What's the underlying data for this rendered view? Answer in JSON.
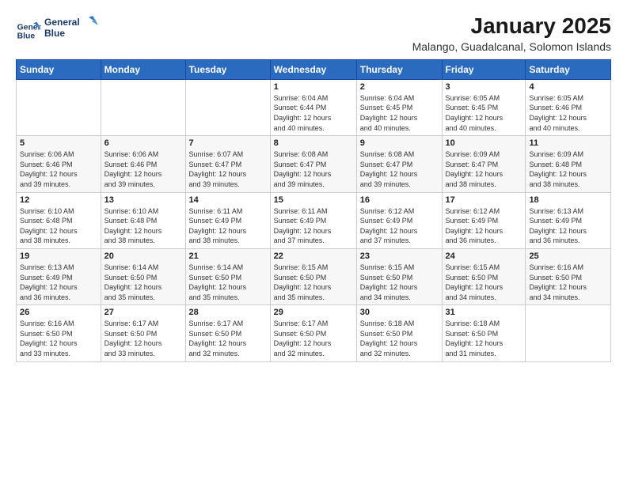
{
  "logo": {
    "line1": "General",
    "line2": "Blue"
  },
  "title": "January 2025",
  "subtitle": "Malango, Guadalcanal, Solomon Islands",
  "weekdays": [
    "Sunday",
    "Monday",
    "Tuesday",
    "Wednesday",
    "Thursday",
    "Friday",
    "Saturday"
  ],
  "weeks": [
    [
      {
        "day": "",
        "info": ""
      },
      {
        "day": "",
        "info": ""
      },
      {
        "day": "",
        "info": ""
      },
      {
        "day": "1",
        "info": "Sunrise: 6:04 AM\nSunset: 6:44 PM\nDaylight: 12 hours\nand 40 minutes."
      },
      {
        "day": "2",
        "info": "Sunrise: 6:04 AM\nSunset: 6:45 PM\nDaylight: 12 hours\nand 40 minutes."
      },
      {
        "day": "3",
        "info": "Sunrise: 6:05 AM\nSunset: 6:45 PM\nDaylight: 12 hours\nand 40 minutes."
      },
      {
        "day": "4",
        "info": "Sunrise: 6:05 AM\nSunset: 6:46 PM\nDaylight: 12 hours\nand 40 minutes."
      }
    ],
    [
      {
        "day": "5",
        "info": "Sunrise: 6:06 AM\nSunset: 6:46 PM\nDaylight: 12 hours\nand 39 minutes."
      },
      {
        "day": "6",
        "info": "Sunrise: 6:06 AM\nSunset: 6:46 PM\nDaylight: 12 hours\nand 39 minutes."
      },
      {
        "day": "7",
        "info": "Sunrise: 6:07 AM\nSunset: 6:47 PM\nDaylight: 12 hours\nand 39 minutes."
      },
      {
        "day": "8",
        "info": "Sunrise: 6:08 AM\nSunset: 6:47 PM\nDaylight: 12 hours\nand 39 minutes."
      },
      {
        "day": "9",
        "info": "Sunrise: 6:08 AM\nSunset: 6:47 PM\nDaylight: 12 hours\nand 39 minutes."
      },
      {
        "day": "10",
        "info": "Sunrise: 6:09 AM\nSunset: 6:47 PM\nDaylight: 12 hours\nand 38 minutes."
      },
      {
        "day": "11",
        "info": "Sunrise: 6:09 AM\nSunset: 6:48 PM\nDaylight: 12 hours\nand 38 minutes."
      }
    ],
    [
      {
        "day": "12",
        "info": "Sunrise: 6:10 AM\nSunset: 6:48 PM\nDaylight: 12 hours\nand 38 minutes."
      },
      {
        "day": "13",
        "info": "Sunrise: 6:10 AM\nSunset: 6:48 PM\nDaylight: 12 hours\nand 38 minutes."
      },
      {
        "day": "14",
        "info": "Sunrise: 6:11 AM\nSunset: 6:49 PM\nDaylight: 12 hours\nand 38 minutes."
      },
      {
        "day": "15",
        "info": "Sunrise: 6:11 AM\nSunset: 6:49 PM\nDaylight: 12 hours\nand 37 minutes."
      },
      {
        "day": "16",
        "info": "Sunrise: 6:12 AM\nSunset: 6:49 PM\nDaylight: 12 hours\nand 37 minutes."
      },
      {
        "day": "17",
        "info": "Sunrise: 6:12 AM\nSunset: 6:49 PM\nDaylight: 12 hours\nand 36 minutes."
      },
      {
        "day": "18",
        "info": "Sunrise: 6:13 AM\nSunset: 6:49 PM\nDaylight: 12 hours\nand 36 minutes."
      }
    ],
    [
      {
        "day": "19",
        "info": "Sunrise: 6:13 AM\nSunset: 6:49 PM\nDaylight: 12 hours\nand 36 minutes."
      },
      {
        "day": "20",
        "info": "Sunrise: 6:14 AM\nSunset: 6:50 PM\nDaylight: 12 hours\nand 35 minutes."
      },
      {
        "day": "21",
        "info": "Sunrise: 6:14 AM\nSunset: 6:50 PM\nDaylight: 12 hours\nand 35 minutes."
      },
      {
        "day": "22",
        "info": "Sunrise: 6:15 AM\nSunset: 6:50 PM\nDaylight: 12 hours\nand 35 minutes."
      },
      {
        "day": "23",
        "info": "Sunrise: 6:15 AM\nSunset: 6:50 PM\nDaylight: 12 hours\nand 34 minutes."
      },
      {
        "day": "24",
        "info": "Sunrise: 6:15 AM\nSunset: 6:50 PM\nDaylight: 12 hours\nand 34 minutes."
      },
      {
        "day": "25",
        "info": "Sunrise: 6:16 AM\nSunset: 6:50 PM\nDaylight: 12 hours\nand 34 minutes."
      }
    ],
    [
      {
        "day": "26",
        "info": "Sunrise: 6:16 AM\nSunset: 6:50 PM\nDaylight: 12 hours\nand 33 minutes."
      },
      {
        "day": "27",
        "info": "Sunrise: 6:17 AM\nSunset: 6:50 PM\nDaylight: 12 hours\nand 33 minutes."
      },
      {
        "day": "28",
        "info": "Sunrise: 6:17 AM\nSunset: 6:50 PM\nDaylight: 12 hours\nand 32 minutes."
      },
      {
        "day": "29",
        "info": "Sunrise: 6:17 AM\nSunset: 6:50 PM\nDaylight: 12 hours\nand 32 minutes."
      },
      {
        "day": "30",
        "info": "Sunrise: 6:18 AM\nSunset: 6:50 PM\nDaylight: 12 hours\nand 32 minutes."
      },
      {
        "day": "31",
        "info": "Sunrise: 6:18 AM\nSunset: 6:50 PM\nDaylight: 12 hours\nand 31 minutes."
      },
      {
        "day": "",
        "info": ""
      }
    ]
  ]
}
